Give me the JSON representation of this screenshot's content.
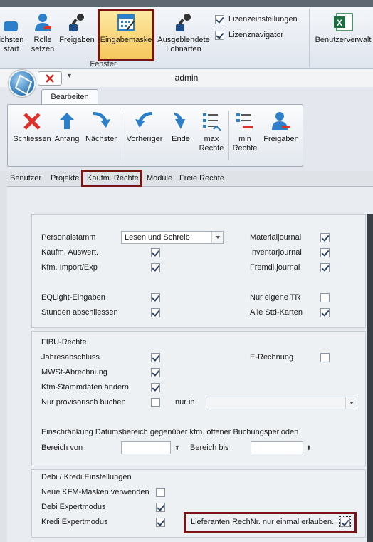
{
  "top_ribbon": {
    "buttons": [
      {
        "label": "ichsten\nstart"
      },
      {
        "label": "Rolle\nsetzen"
      },
      {
        "label": "Freigaben"
      },
      {
        "label": "Eingabemaske"
      },
      {
        "label": "Ausgeblendete\nLohnarten"
      },
      {
        "label": "Benutzerverwalt"
      }
    ],
    "checks": [
      {
        "label": "Lizenzeinstellungen",
        "checked": true
      },
      {
        "label": "Lizenznavigator",
        "checked": true
      }
    ],
    "group_label": "Fenster"
  },
  "window": {
    "title": "admin",
    "ribbon_tab": "Bearbeiten",
    "buttons": [
      {
        "label": "Schliessen"
      },
      {
        "label": "Anfang"
      },
      {
        "label": "Nächster"
      },
      {
        "label": "Vorheriger"
      },
      {
        "label": "Ende"
      },
      {
        "label": "max\nRechte"
      },
      {
        "label": "min\nRechte"
      },
      {
        "label": "Freigaben"
      }
    ]
  },
  "tabs": [
    "Benutzer",
    "Projekte",
    "Kaufm. Rechte",
    "Module",
    "Freie Rechte"
  ],
  "panel1": {
    "personalstamm_label": "Personalstamm",
    "personalstamm_value": "Lesen und Schreib",
    "rows_left": [
      {
        "label": "Kaufm. Auswert.",
        "checked": true
      },
      {
        "label": "Kfm. Import/Exp",
        "checked": true
      },
      {
        "label": "EQLight-Eingaben",
        "checked": true
      },
      {
        "label": "Stunden abschliessen",
        "checked": true
      }
    ],
    "rows_right": [
      {
        "label": "Materialjournal",
        "checked": true
      },
      {
        "label": "Inventarjournal",
        "checked": true
      },
      {
        "label": "Fremdl.journal",
        "checked": true
      },
      {
        "label": "Nur eigene TR",
        "checked": false
      },
      {
        "label": "Alle Std-Karten",
        "checked": true
      }
    ]
  },
  "panel2": {
    "title": "FIBU-Rechte",
    "rows": [
      {
        "label": "Jahresabschluss",
        "checked": true
      },
      {
        "label": "MWSt-Abrechnung",
        "checked": true
      },
      {
        "label": "Kfm-Stammdaten ändern",
        "checked": true
      },
      {
        "label": "Nur provisorisch buchen",
        "checked": false
      }
    ],
    "erechnung": {
      "label": "E-Rechnung",
      "checked": false
    },
    "nur_in_label": "nur in",
    "nur_in_value": "",
    "restriction_text": "Einschränkung Datumsbereich gegenüber kfm. offener Buchungsperioden",
    "bereich_von_label": "Bereich von",
    "bereich_von_value": "",
    "bereich_bis_label": "Bereich bis",
    "bereich_bis_value": ""
  },
  "panel3": {
    "title": "Debi / Kredi Einstellungen",
    "rows": [
      {
        "label": "Neue KFM-Masken verwenden",
        "checked": false
      },
      {
        "label": "Debi Expertmodus",
        "checked": true
      },
      {
        "label": "Kredi Expertmodus",
        "checked": true
      }
    ],
    "lieferanten": {
      "label": "Lieferanten RechNr. nur einmal erlauben.",
      "checked": true
    }
  },
  "colors": {
    "highlight_border": "#7a1414",
    "icon_blue": "#2d7fc9",
    "icon_red": "#e0302a"
  }
}
